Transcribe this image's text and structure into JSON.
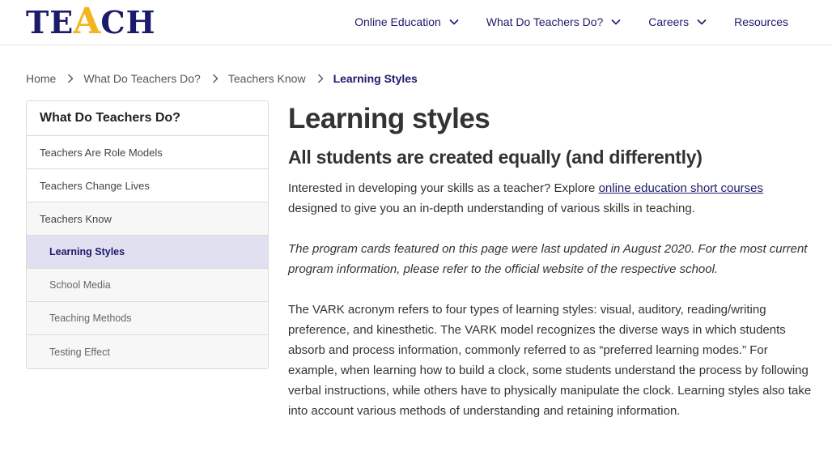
{
  "logo": {
    "before": "TE",
    "accent": "A",
    "after": "CH"
  },
  "nav": {
    "items": [
      {
        "label": "Online Education",
        "dropdown": true
      },
      {
        "label": "What Do Teachers Do?",
        "dropdown": true
      },
      {
        "label": "Careers",
        "dropdown": true
      },
      {
        "label": "Resources",
        "dropdown": false
      }
    ]
  },
  "breadcrumb": [
    "Home",
    "What Do Teachers Do?",
    "Teachers Know",
    "Learning Styles"
  ],
  "sidebar": {
    "heading": "What Do Teachers Do?",
    "items": [
      "Teachers Are Role Models",
      "Teachers Change Lives",
      "Teachers Know",
      "Learning Styles",
      "School Media",
      "Teaching Methods",
      "Testing Effect"
    ]
  },
  "main": {
    "title": "Learning styles",
    "subtitle": "All students are created equally (and differently)",
    "intro_before": "Interested in developing your skills as a teacher? Explore ",
    "intro_link": "online education short courses",
    "intro_after": " designed to give you an in-depth understanding of various skills in teaching.",
    "notice": "The program cards featured on this page were last updated in August 2020. For the most current program information, please refer to the official website of the respective school.",
    "body": "The VARK acronym refers to four types of learning styles: visual, auditory, reading/writing preference, and kinesthetic. The VARK model recognizes the diverse ways in which students absorb and process information, commonly referred to as “preferred learning modes.” For example, when learning how to build a clock, some students understand the process by following verbal instructions, while others have to physically manipulate the clock. Learning styles also take into account various methods of understanding and retaining information."
  },
  "colors": {
    "brand": "#1c1a6b",
    "accent": "#f2b41f",
    "active_bg": "#e0e0f0"
  }
}
